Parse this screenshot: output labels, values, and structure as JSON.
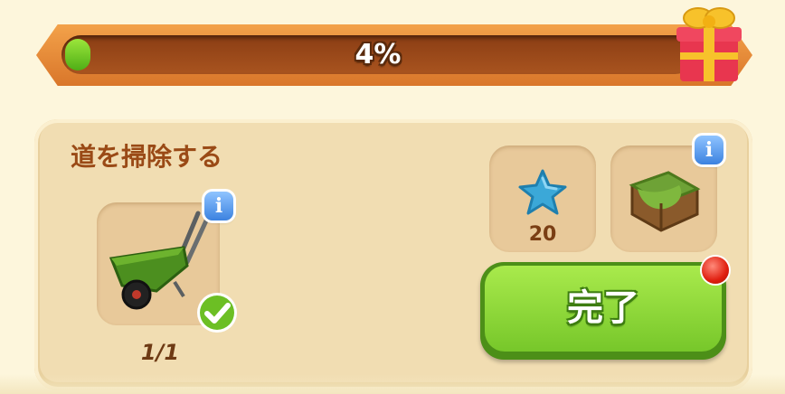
{
  "progress": {
    "label": "4%",
    "fraction": 0.04,
    "fill_color": "#5fbe1e",
    "reward_icon": "gift-box-icon"
  },
  "task": {
    "title": "道を掃除する",
    "requirement": {
      "icon": "wheelbarrow-icon",
      "count": "1/1",
      "complete": true,
      "info_label": "i"
    },
    "rewards": [
      {
        "icon": "blue-star-icon",
        "amount": "20"
      },
      {
        "icon": "grass-crate-icon",
        "info_label": "i"
      }
    ],
    "complete_button": {
      "label": "完了",
      "color": "#77c72a",
      "has_notification": true
    }
  }
}
